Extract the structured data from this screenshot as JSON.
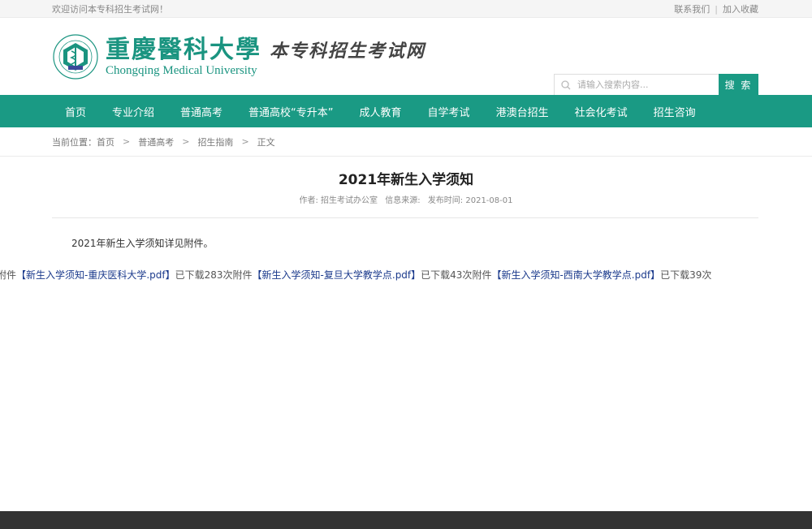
{
  "topbar": {
    "welcome": "欢迎访问本专科招生考试网！",
    "contact": "联系我们",
    "separator": "|",
    "bookmark": "加入收藏"
  },
  "header": {
    "logo_cn": "重慶醫科大學",
    "logo_en": "Chongqing Medical University",
    "site_name": "本专科招生考试网"
  },
  "search": {
    "placeholder": "请输入搜索内容...",
    "button": "搜 索"
  },
  "nav": {
    "items": [
      {
        "label": "首页"
      },
      {
        "label": "专业介绍"
      },
      {
        "label": "普通高考"
      },
      {
        "label": "普通高校“专升本”"
      },
      {
        "label": "成人教育"
      },
      {
        "label": "自学考试"
      },
      {
        "label": "港澳台招生"
      },
      {
        "label": "社会化考试"
      },
      {
        "label": "招生咨询"
      }
    ]
  },
  "breadcrumb": {
    "prefix": "当前位置：",
    "items": [
      "首页",
      "普通高考",
      "招生指南",
      "正文"
    ],
    "arrow": ">"
  },
  "article": {
    "title": "2021年新生入学须知",
    "author": "作者: 招生考试办公室",
    "source": "信息来源:",
    "date": "发布时间: 2021-08-01",
    "body": "2021年新生入学须知详见附件。",
    "attachments": [
      {
        "prefix": "附件",
        "name": "【新生入学须知-重庆医科大学.pdf】",
        "downloads": "已下载283次"
      },
      {
        "prefix": "附件",
        "name": "【新生入学须知-复旦大学教学点.pdf】",
        "downloads": "已下载43次"
      },
      {
        "prefix": "附件",
        "name": "【新生入学须知-西南大学教学点.pdf】",
        "downloads": "已下载39次"
      }
    ]
  },
  "colors": {
    "brand": "#1a9a84",
    "link": "#1b3a8c",
    "footer_bg": "#333333"
  }
}
